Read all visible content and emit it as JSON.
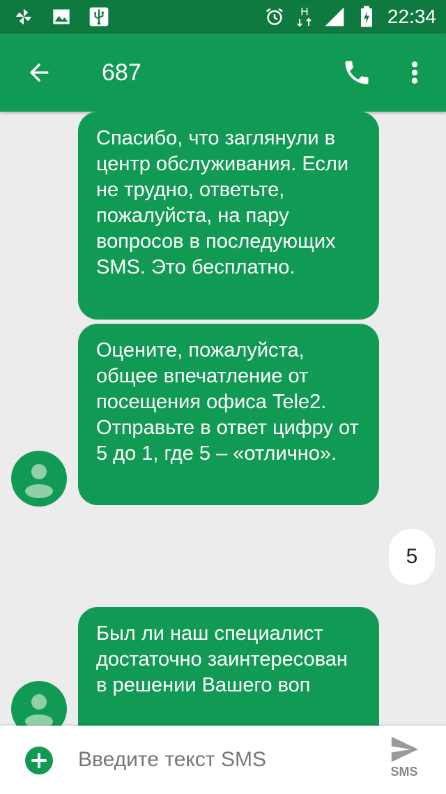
{
  "status_bar": {
    "time": "22:34",
    "network_type": "H",
    "icons": [
      "pinwheel-icon",
      "image-icon",
      "usb-icon",
      "alarm-icon",
      "network-arrows-icon",
      "signal-icon",
      "battery-charging-icon"
    ]
  },
  "toolbar": {
    "title": "687",
    "back_icon": "arrow-back-icon",
    "call_icon": "phone-icon",
    "more_icon": "more-vert-icon"
  },
  "messages": [
    {
      "direction": "incoming",
      "text": "Спасибо, что заглянули в центр обслуживания. Если не трудно, ответьте, пожалуйста, на пару вопросов в последующих SMS. Это бесплатно."
    },
    {
      "direction": "incoming",
      "text": "Оцените, пожалуйста, общее впечатление от посещения офиса Tele2. Отправьте в ответ цифру от 5 до 1, где 5 – «отлично»."
    },
    {
      "direction": "outgoing",
      "text": "5"
    },
    {
      "direction": "incoming",
      "text": "Был ли наш специалист достаточно заинтересован в решении Вашего воп"
    }
  ],
  "compose": {
    "placeholder": "Введите текст SMS",
    "send_label": "SMS"
  },
  "colors": {
    "status_bar": "#0e7a3f",
    "toolbar": "#119a54",
    "bubble_incoming": "#119a54",
    "bubble_outgoing": "#ffffff",
    "background": "#ececec"
  }
}
